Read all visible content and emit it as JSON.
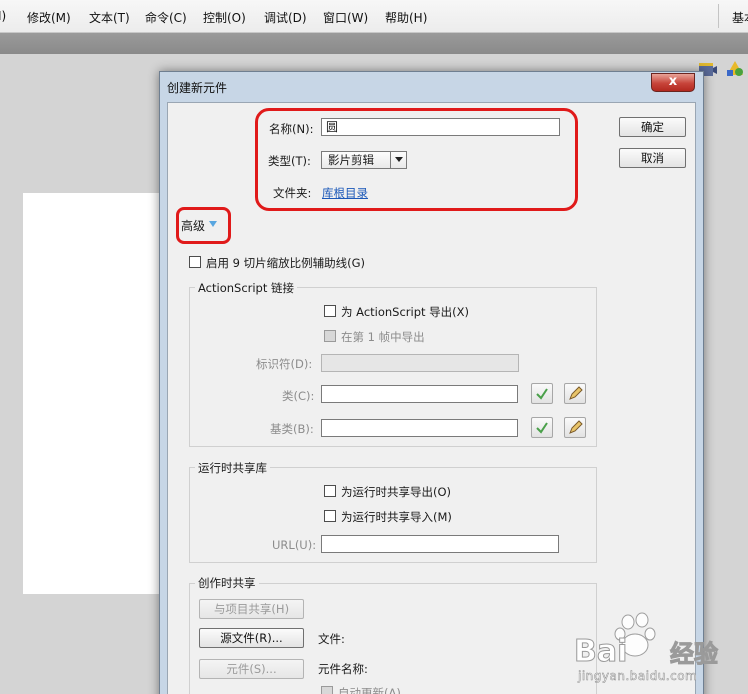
{
  "menubar": {
    "items": [
      "I)",
      "修改(M)",
      "文本(T)",
      "命令(C)",
      "控制(O)",
      "调试(D)",
      "窗口(W)",
      "帮助(H)",
      "基本"
    ]
  },
  "dialog": {
    "title": "创建新元件",
    "close_label": "x",
    "name_label": "名称(N):",
    "name_value": "圆",
    "type_label": "类型(T):",
    "type_value": "影片剪辑",
    "folder_label": "文件夹:",
    "folder_link": "库根目录",
    "ok_button": "确定",
    "cancel_button": "取消",
    "advanced_label": "高级",
    "nine_slice_label": "启用 9 切片缩放比例辅助线(G)",
    "actionscript": {
      "title": "ActionScript 链接",
      "export_label": "为 ActionScript 导出(X)",
      "export_frame1_label": "在第 1 帧中导出",
      "identifier_label": "标识符(D):",
      "class_label": "类(C):",
      "base_class_label": "基类(B):"
    },
    "runtime_sharing": {
      "title": "运行时共享库",
      "export_label": "为运行时共享导出(O)",
      "import_label": "为运行时共享导入(M)",
      "url_label": "URL(U):"
    },
    "authoring_sharing": {
      "title": "创作时共享",
      "share_button": "与项目共享(H)",
      "source_file_button": "源文件(R)...",
      "file_label": "文件:",
      "symbol_button": "元件(S)...",
      "symbol_name_label": "元件名称:",
      "auto_update_label": "自动更新(A)"
    }
  },
  "watermark": {
    "brand": "Bai",
    "brand_cn": "经验",
    "url": "jingyan.baidu.com"
  },
  "colors": {
    "annotation": "#e01a1a",
    "link": "#1a57b8",
    "title_bar": "#c7d6e6"
  }
}
